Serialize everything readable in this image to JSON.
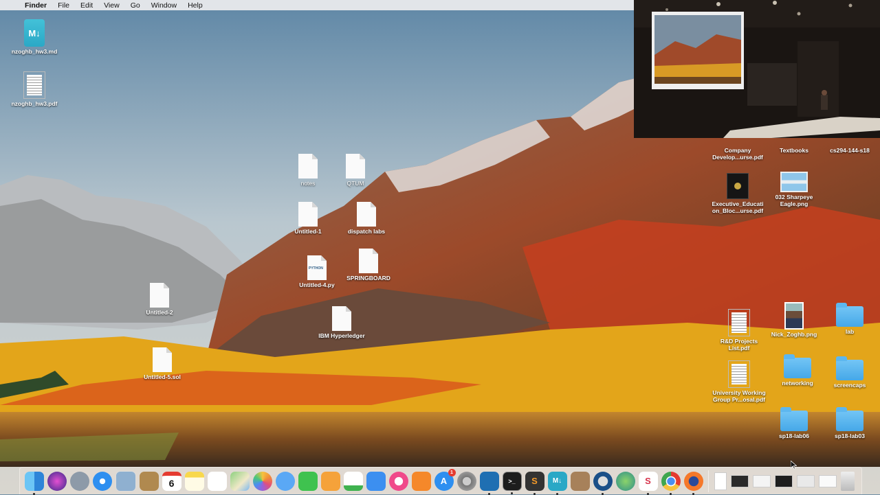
{
  "menubar": {
    "app_name": "Finder",
    "items": [
      "File",
      "Edit",
      "View",
      "Go",
      "Window",
      "Help"
    ]
  },
  "desktop_icons": {
    "md_file": "nzoghb_hw3.md",
    "pdf_file": "nzoghb_hw3.pdf",
    "notes": "notes",
    "qtum": "QTUM",
    "untitled1": "Untitled-1",
    "dispatch": "dispatch labs",
    "untitled4": "Untitled-4.py",
    "springboard": "SPRINGBOARD",
    "untitled2": "Untitled-2",
    "ibm": "IBM Hyperledger",
    "untitled5": "Untitled-5.sol",
    "company": "Company Develop...urse.pdf",
    "textbooks": "Textbooks",
    "cs294": "cs294-144-s18",
    "executive": "Executive_Educati on_Bloc...urse.pdf",
    "sharpeye": "032 Sharpeye Eagle.png",
    "rnd": "R&D Projects List.pdf",
    "nick": "Nick_Zoghb.png",
    "lab": "lab",
    "university": "University Working Group Pr...osal.pdf",
    "networking": "networking",
    "screencaps": "screencaps",
    "sp18lab06": "sp18-lab06",
    "sp18lab03": "sp18-lab03",
    "python_tag": "PYTHON",
    "md_glyph": "M↓"
  },
  "dock": {
    "calendar_day": "6",
    "appstore_badge": "1",
    "sublime_glyph": "S",
    "markdown_glyph": "M↓"
  }
}
